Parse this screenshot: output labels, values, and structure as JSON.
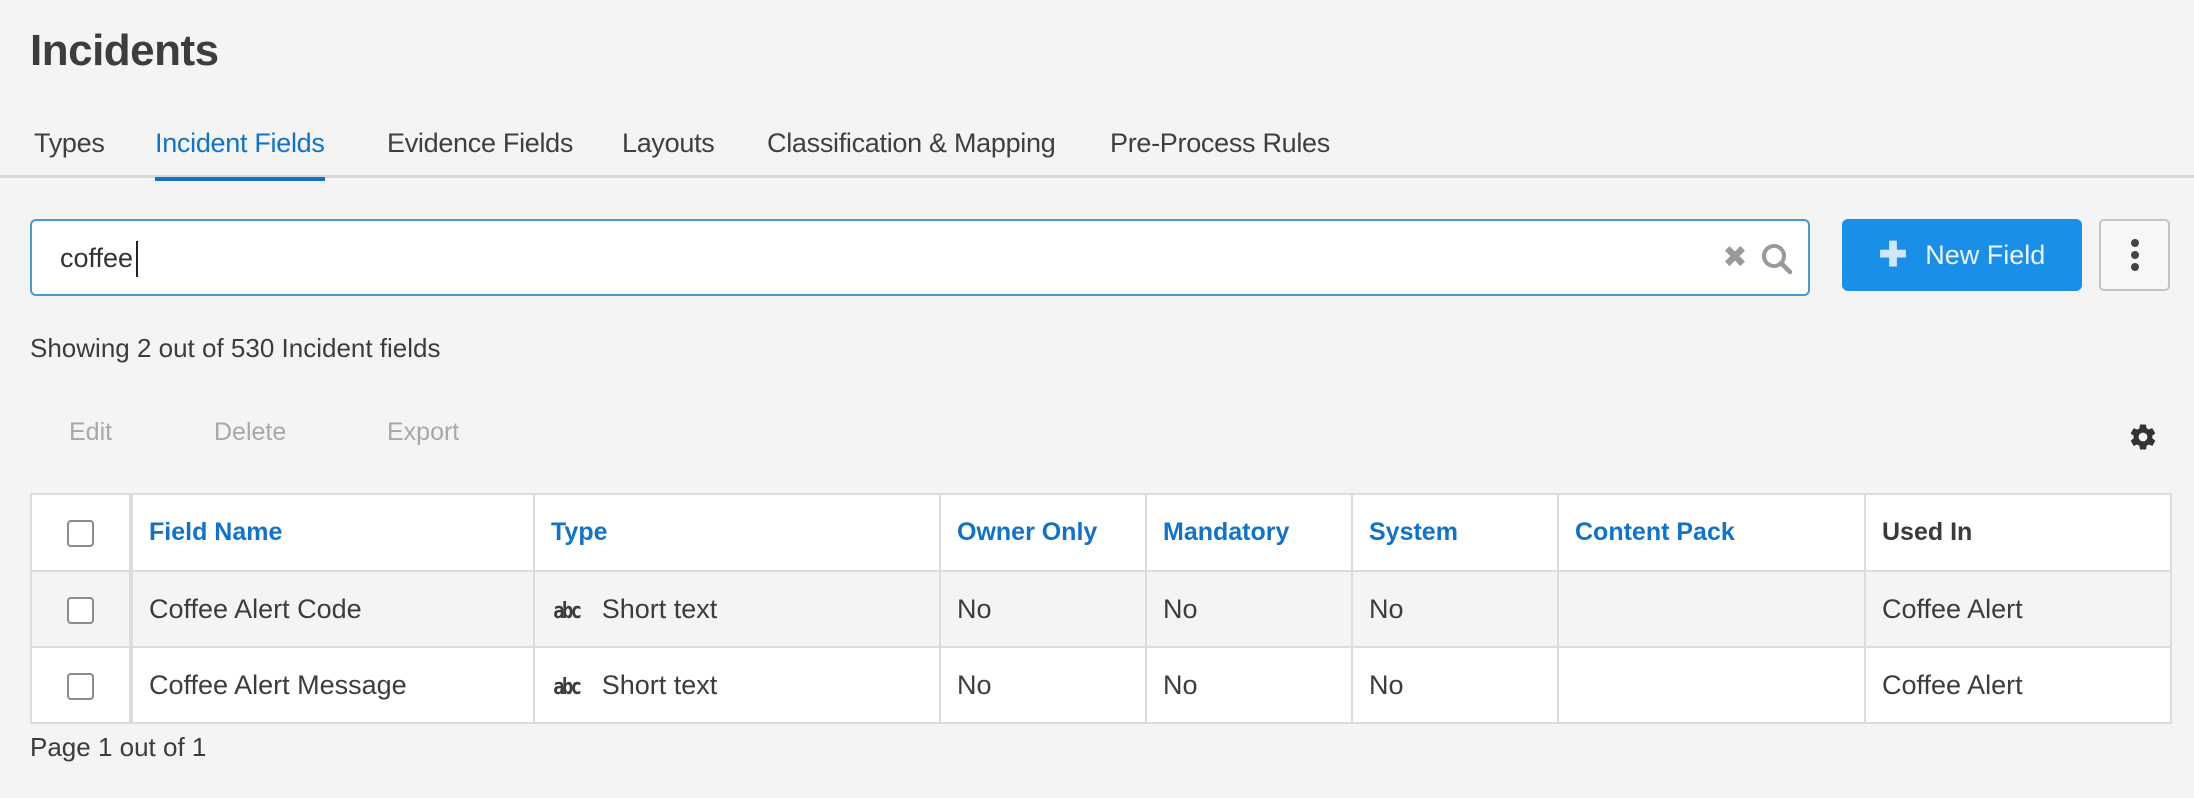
{
  "page": {
    "title": "Incidents"
  },
  "tabs": [
    {
      "label": "Types",
      "active": false
    },
    {
      "label": "Incident Fields",
      "active": true
    },
    {
      "label": "Evidence Fields",
      "active": false
    },
    {
      "label": "Layouts",
      "active": false
    },
    {
      "label": "Classification & Mapping",
      "active": false
    },
    {
      "label": "Pre-Process Rules",
      "active": false
    }
  ],
  "search": {
    "value": "coffee",
    "clear_icon": "close-icon",
    "search_icon": "search-icon"
  },
  "actions": {
    "new_field_label": "New Field",
    "new_field_icon": "plus-icon",
    "more_icon": "kebab-icon"
  },
  "summary": "Showing 2 out of 530 Incident fields",
  "toolbar": {
    "edit_label": "Edit",
    "delete_label": "Delete",
    "export_label": "Export",
    "settings_icon": "gear-icon"
  },
  "table": {
    "columns": [
      "Field Name",
      "Type",
      "Owner Only",
      "Mandatory",
      "System",
      "Content Pack",
      "Used In"
    ],
    "rows": [
      {
        "field_name": "Coffee Alert Code",
        "type_icon": "abc",
        "type": "Short text",
        "owner_only": "No",
        "mandatory": "No",
        "system": "No",
        "content_pack": "",
        "used_in": "Coffee Alert"
      },
      {
        "field_name": "Coffee Alert Message",
        "type_icon": "abc",
        "type": "Short text",
        "owner_only": "No",
        "mandatory": "No",
        "system": "No",
        "content_pack": "",
        "used_in": "Coffee Alert"
      }
    ]
  },
  "pager": "Page 1 out of 1",
  "colors": {
    "accent": "#1273c6",
    "primary_button": "#1a8fe8",
    "background": "#f4f4f4",
    "border": "#dcdcdc",
    "disabled_text": "#a8a8a8"
  }
}
